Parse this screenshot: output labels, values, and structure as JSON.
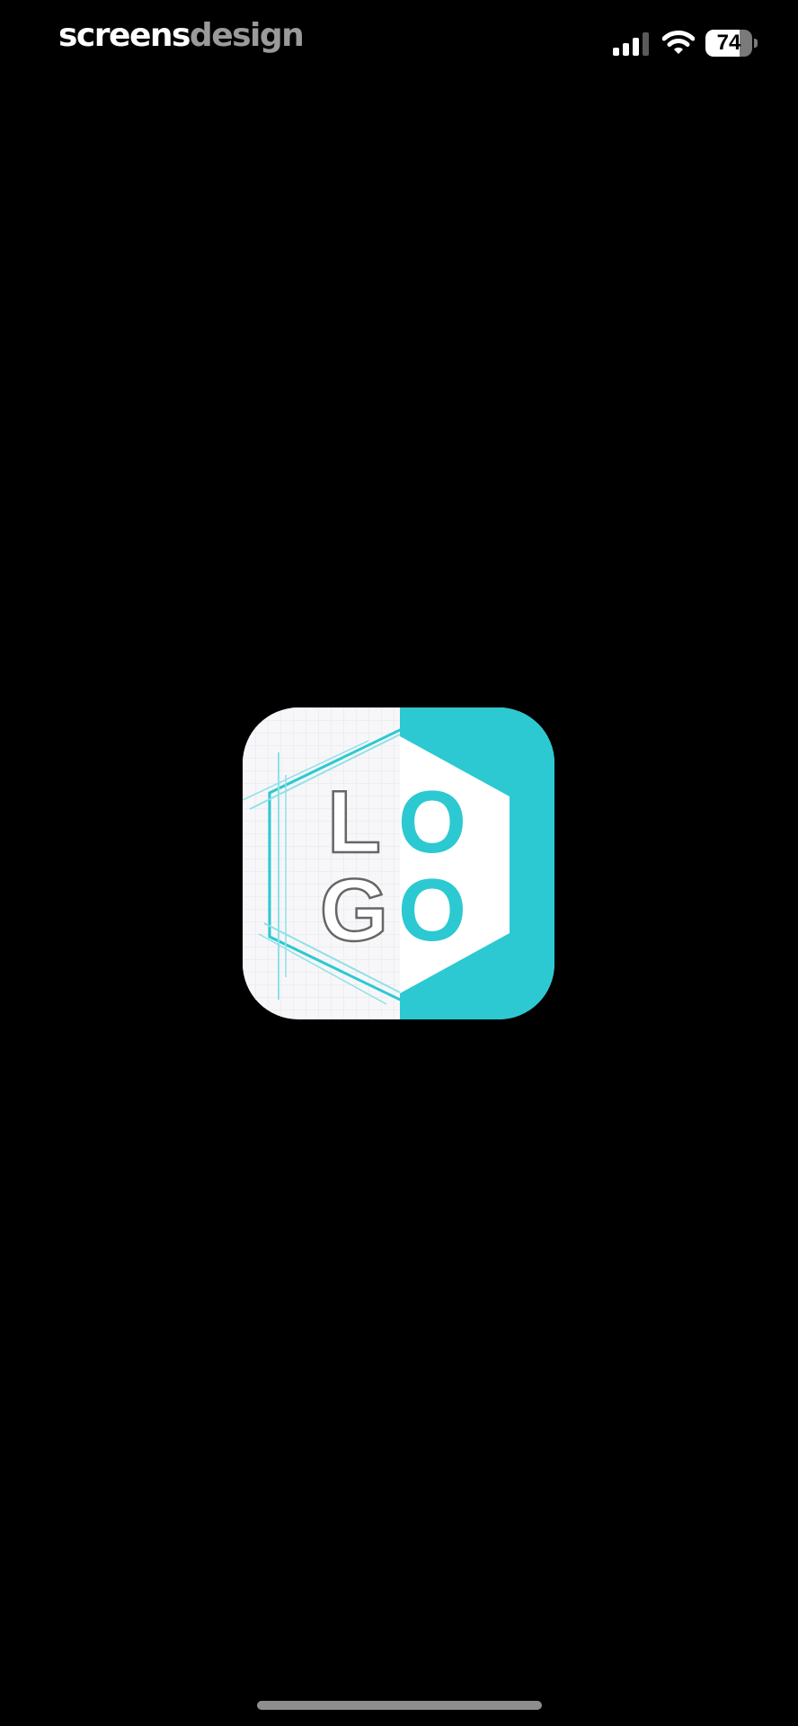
{
  "status_bar": {
    "watermark_part1": "screens",
    "watermark_part2": "design",
    "battery_level": "74",
    "battery_fraction": 0.74,
    "signal_bars_active": 3,
    "signal_bars_total": 4
  },
  "splash": {
    "logo_letters": [
      "L",
      "O",
      "G",
      "O"
    ],
    "accent_color": "#2cc9d2",
    "tile_color": "#f7f7f9",
    "letter_outline_color": "#666666"
  },
  "icons": {
    "signal": "cellular-signal-icon",
    "wifi": "wifi-icon",
    "battery": "battery-icon"
  }
}
